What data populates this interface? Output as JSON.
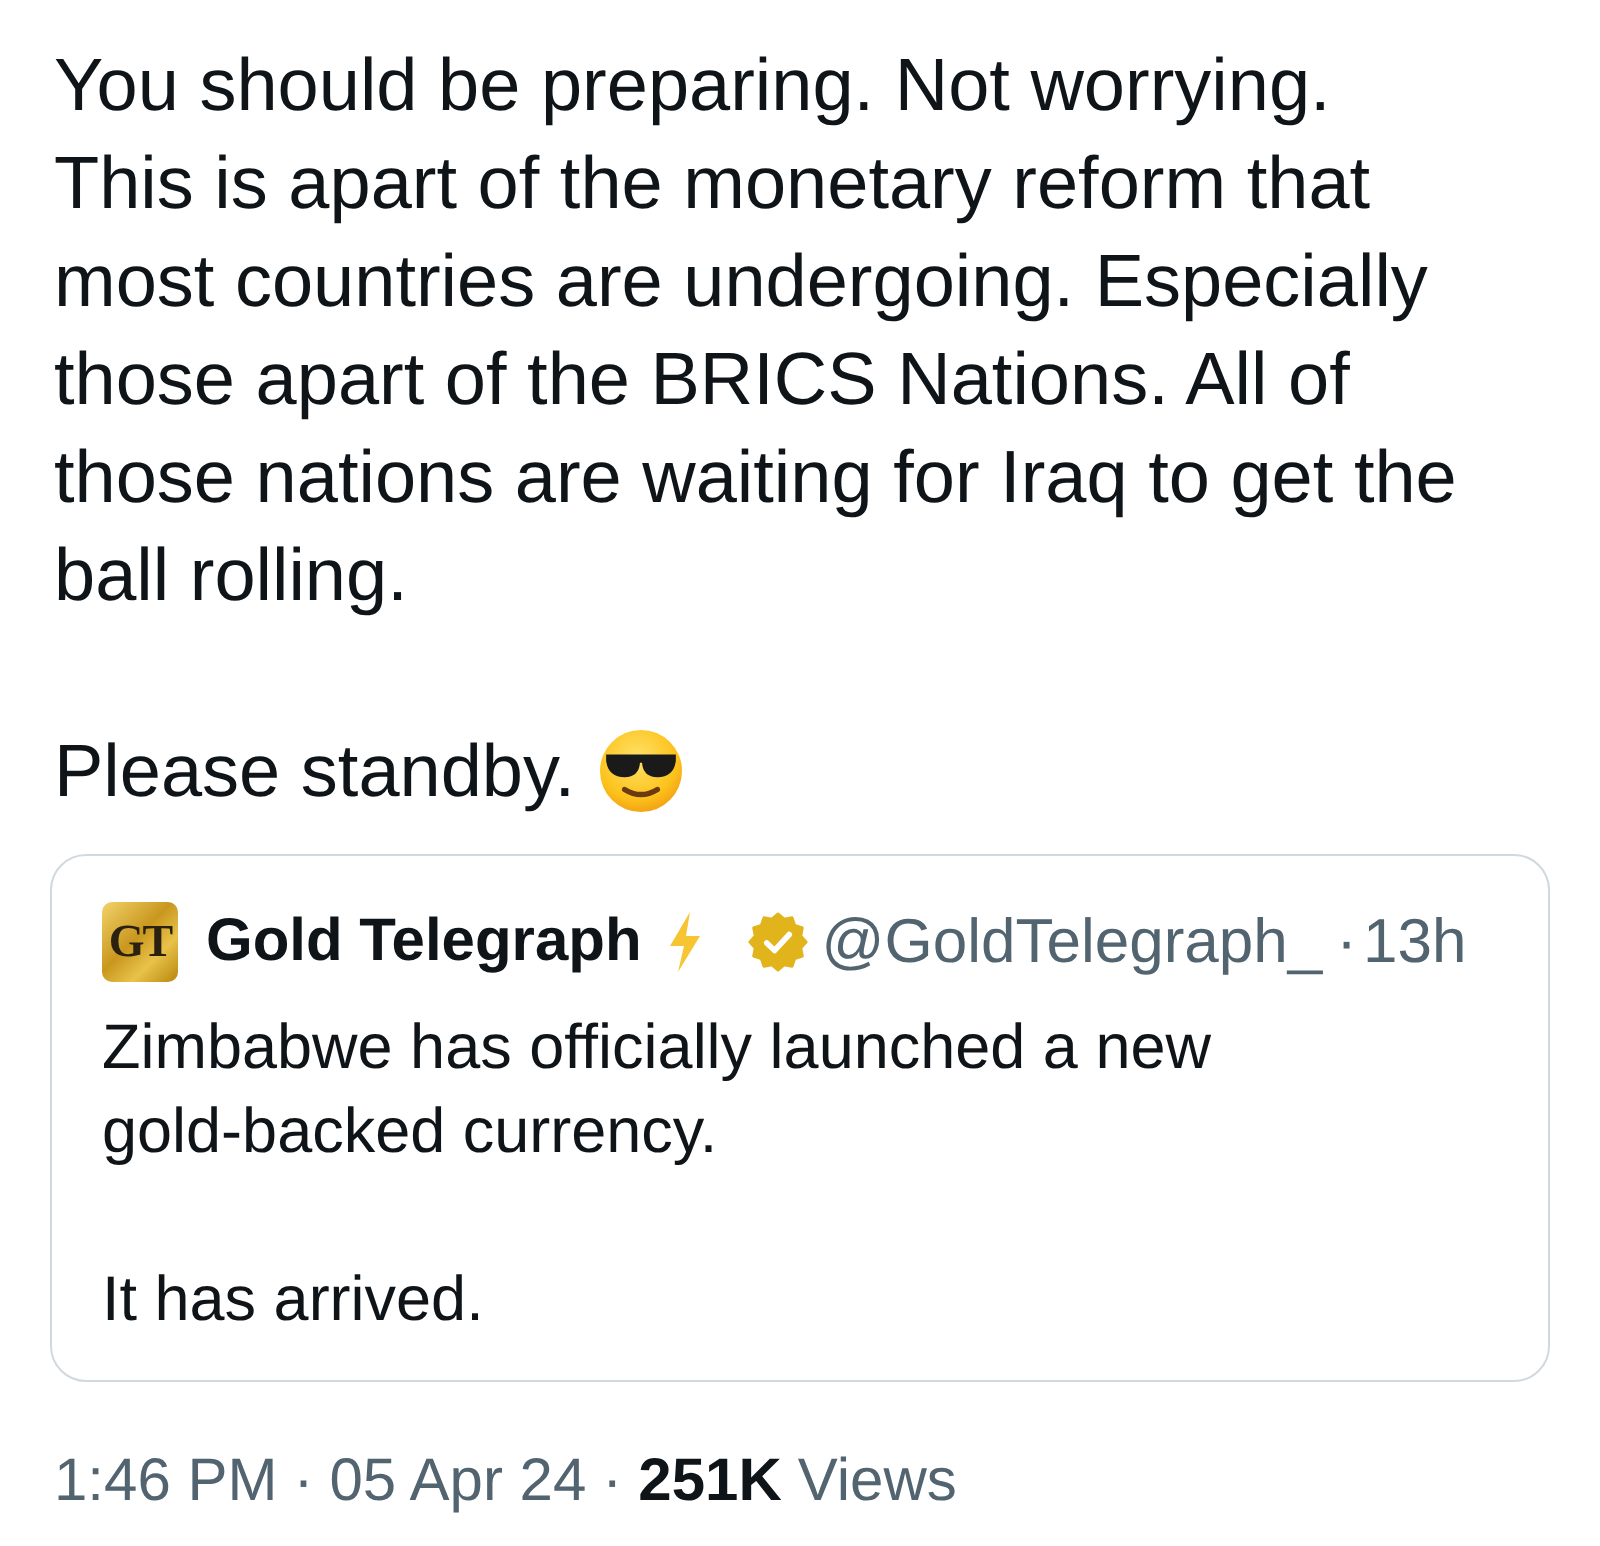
{
  "post": {
    "paragraphs": [
      [
        "You should be preparing. Not worrying.",
        "This is apart of the monetary reform that most countries are undergoing. Especially those apart of the BRICS Nations. All of those nations are waiting for Iraq to get the ball rolling."
      ],
      [
        "Please standby."
      ]
    ]
  },
  "quoted_post": {
    "author": {
      "logo_text": "GT",
      "name": "Gold Telegraph",
      "verified": true,
      "handle": "@GoldTelegraph_",
      "separator": "·",
      "time": "13h"
    },
    "paragraphs": [
      [
        "Zimbabwe has officially launched a new gold-backed currency."
      ],
      [
        "It has arrived."
      ]
    ]
  },
  "footer": [
    {
      "kind": "time",
      "text": "1:46 PM"
    },
    {
      "kind": "separator",
      "text": "·"
    },
    {
      "kind": "date",
      "text": "05 Apr 24"
    },
    {
      "kind": "separator",
      "text": "·"
    },
    {
      "kind": "count",
      "text": "251K"
    },
    {
      "kind": "label",
      "text": "Views"
    }
  ]
}
